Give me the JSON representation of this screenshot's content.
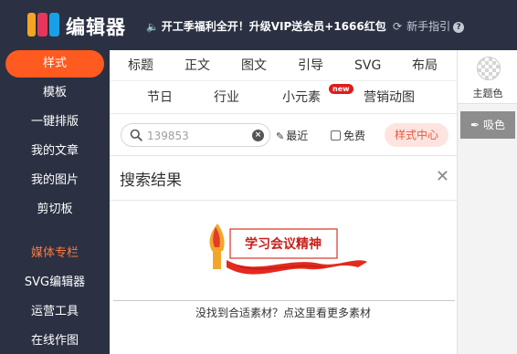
{
  "app": {
    "logo_text": "编辑器",
    "promo_text": "开工季福利全开！升级VIP送会员+1666红包",
    "guide_text": "新手指引"
  },
  "colors": {
    "topbar_bg": "#2b3143",
    "accent": "#ff5a1f",
    "logo_bars": [
      "#f4a623",
      "#e6365e",
      "#1aa0e6"
    ]
  },
  "icons": {
    "speaker": "speaker-icon",
    "refresh": "refresh-icon",
    "help": "question-icon",
    "search": "search-icon",
    "clear": "clear-icon",
    "wand": "magic-wand-icon",
    "close": "close-icon",
    "eyedropper": "eyedropper-icon"
  },
  "sidebar": {
    "items": [
      {
        "label": "样式",
        "active": true
      },
      {
        "label": "模板"
      },
      {
        "label": "一键排版"
      },
      {
        "label": "我的文章"
      },
      {
        "label": "我的图片"
      },
      {
        "label": "剪切板"
      },
      {
        "label": "媒体专栏",
        "highlight": true
      },
      {
        "label": "SVG编辑器"
      },
      {
        "label": "运营工具"
      },
      {
        "label": "在线作图"
      }
    ]
  },
  "tabs": {
    "row1": [
      "标题",
      "正文",
      "图文",
      "引导",
      "SVG",
      "布局"
    ],
    "row2": [
      "节日",
      "行业",
      "小元素",
      "营销动图"
    ],
    "new_badge": "new"
  },
  "filter": {
    "search_placeholder": "139853",
    "recent_label": "最近",
    "free_label": "免费",
    "free_checked": false,
    "style_center_label": "样式中心"
  },
  "results": {
    "title": "搜索结果",
    "banner_text": "学习会议精神",
    "more_link": "没找到合适素材？点这里看更多素材"
  },
  "right_panel": {
    "theme_label": "主题色",
    "eyedropper_label": "吸色"
  }
}
